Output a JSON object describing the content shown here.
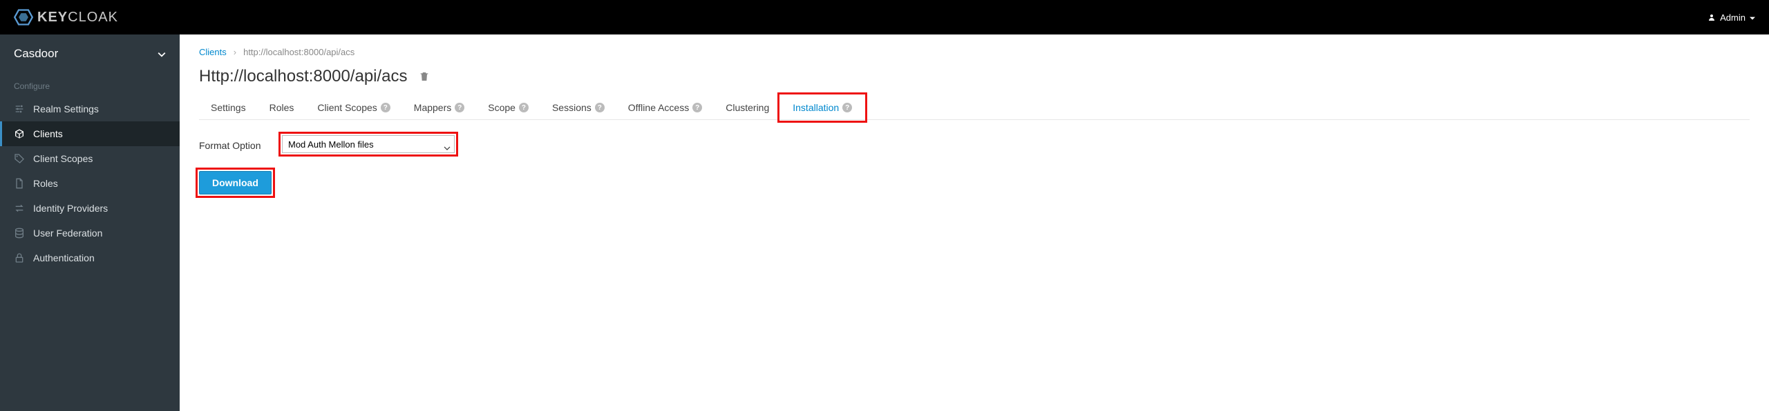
{
  "header": {
    "logo_text_bold": "KEY",
    "logo_text_rest": "CLOAK",
    "user_label": "Admin"
  },
  "sidebar": {
    "realm": "Casdoor",
    "section_label": "Configure",
    "items": [
      {
        "label": "Realm Settings",
        "icon": "sliders"
      },
      {
        "label": "Clients",
        "icon": "cube",
        "active": true
      },
      {
        "label": "Client Scopes",
        "icon": "tags"
      },
      {
        "label": "Roles",
        "icon": "file"
      },
      {
        "label": "Identity Providers",
        "icon": "exchange"
      },
      {
        "label": "User Federation",
        "icon": "database"
      },
      {
        "label": "Authentication",
        "icon": "lock"
      }
    ]
  },
  "breadcrumb": {
    "root": "Clients",
    "current": "http://localhost:8000/api/acs"
  },
  "page": {
    "title": "Http://localhost:8000/api/acs"
  },
  "tabs": [
    {
      "label": "Settings",
      "help": false
    },
    {
      "label": "Roles",
      "help": false
    },
    {
      "label": "Client Scopes",
      "help": true
    },
    {
      "label": "Mappers",
      "help": true
    },
    {
      "label": "Scope",
      "help": true
    },
    {
      "label": "Sessions",
      "help": true
    },
    {
      "label": "Offline Access",
      "help": true
    },
    {
      "label": "Clustering",
      "help": false
    },
    {
      "label": "Installation",
      "help": true,
      "active": true
    }
  ],
  "installation": {
    "format_label": "Format Option",
    "format_value": "Mod Auth Mellon files",
    "download_label": "Download"
  }
}
